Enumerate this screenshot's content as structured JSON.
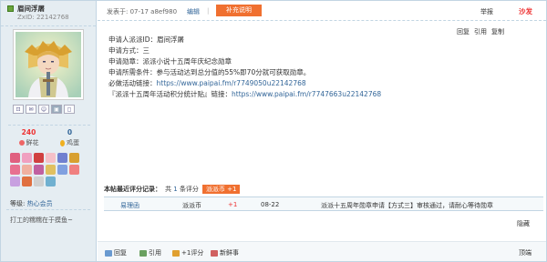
{
  "user": {
    "name": "眉间浮屠",
    "uid": "ZxID: 22142768",
    "flowers_count": "240",
    "flowers_label": "鲜花",
    "eggs_count": "0",
    "eggs_label": "鸡蛋",
    "level_prefix": "等级:",
    "level": "热心会员",
    "signature": "打工的糯糯在于摸鱼~"
  },
  "icons": [
    "profile-icon",
    "message-icon",
    "friend-icon",
    "qq-icon",
    "email-icon"
  ],
  "medals": [
    "#e06080",
    "#f0a0c0",
    "#d04040",
    "#f5c0c8",
    "#7080d0",
    "#d8a030",
    "#e87090",
    "#f0b0a0",
    "#c060a0",
    "#e0c060",
    "#80a0e0",
    "#f08080",
    "#c8a0e0",
    "#e07040",
    "#d0d0d0",
    "#70b0d0"
  ],
  "post": {
    "time": "发表于: 07-17 a8ef980",
    "edit": "编辑",
    "separator": "|",
    "supplement_button": "补充说明",
    "report": "举报",
    "floor": "沙发",
    "actions": [
      "回复",
      "引用",
      "复制"
    ],
    "lines": [
      "申请人派派ID：眉间浮屠",
      "申请方式：三",
      "申请勋章：派派小说十五周年庆纪念勋章",
      "申请所需条件：参与活动达到总分值的55%即70分就可获取勋章。"
    ],
    "link1_label": "必做活动链接：",
    "link1_url": "https://www.paipai.fm/r7749050u22142768",
    "link2_label": "『派派十五周年活动积分统计贴』链接：",
    "link2_url": "https://www.paipai.fm/r7747663u22142768"
  },
  "rating": {
    "title": "本帖最近评分记录：",
    "count_prefix": "共",
    "count": "1",
    "count_suffix": "条评分",
    "tag": "派派币 +1",
    "row": {
      "user": "易理函",
      "currency": "派派币",
      "amount": "+1",
      "date": "08-22",
      "reason": "派派十五周年勋章申请【方式三】审核通过，请耐心等待勋章"
    },
    "hide": "隐藏"
  },
  "bottom": {
    "reply": "回复",
    "quote": "引用",
    "rate": "+1评分",
    "new": "新鲜事",
    "top": "顶端"
  },
  "colors": {
    "accent": "#f07030",
    "link": "#336699",
    "border": "#c2d5e3",
    "sidebar": "#e5edf2",
    "floor": "#ee3333"
  }
}
